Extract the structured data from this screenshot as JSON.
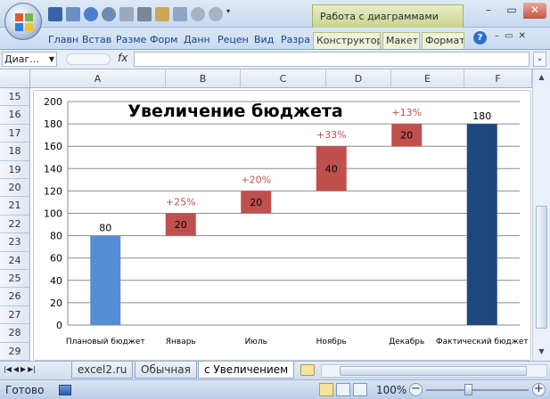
{
  "titlebar": {
    "context_tab_title": "Работа с диаграммами"
  },
  "ribbon": {
    "tabs": [
      "Главн",
      "Встав",
      "Разме",
      "Форм",
      "Данн",
      "Рецен",
      "Вид",
      "Разра"
    ],
    "context_tabs": [
      "Конструктор",
      "Макет",
      "Формат"
    ]
  },
  "formula_bar": {
    "name_box": "Диаг...",
    "fx_label": "fx",
    "formula": ""
  },
  "grid": {
    "columns": [
      "A",
      "B",
      "C",
      "D",
      "E",
      "F"
    ],
    "rows": [
      "15",
      "16",
      "17",
      "18",
      "19",
      "20",
      "21",
      "22",
      "23",
      "24",
      "25",
      "26",
      "27",
      "28",
      "29"
    ]
  },
  "chart_data": {
    "type": "bar",
    "title": "Увеличение бюджета",
    "categories": [
      "Плановый бюджет",
      "Январь",
      "Июль",
      "Ноябрь",
      "Декабрь",
      "Фактический бюджет"
    ],
    "bases": [
      0,
      80,
      100,
      120,
      160,
      0
    ],
    "values": [
      80,
      20,
      20,
      40,
      20,
      180
    ],
    "data_labels": [
      "80",
      "20",
      "20",
      "40",
      "20",
      "180"
    ],
    "pct_labels": [
      "",
      "+25%",
      "+20%",
      "+33%",
      "+13%",
      ""
    ],
    "ylim": [
      0,
      200
    ],
    "yticks": [
      "0",
      "20",
      "40",
      "60",
      "80",
      "100",
      "120",
      "140",
      "160",
      "180",
      "200"
    ],
    "grid": true,
    "legend": "none",
    "colors": {
      "start": "#558ed5",
      "increase": "#c0504d",
      "end": "#1f497d",
      "pct_label": "#c0504d"
    }
  },
  "sheet_tabs": {
    "tabs": [
      "excel2.ru",
      "Обычная",
      "с Увеличением"
    ],
    "active": "с Увеличением"
  },
  "status_bar": {
    "status": "Готово",
    "zoom": "100%"
  }
}
